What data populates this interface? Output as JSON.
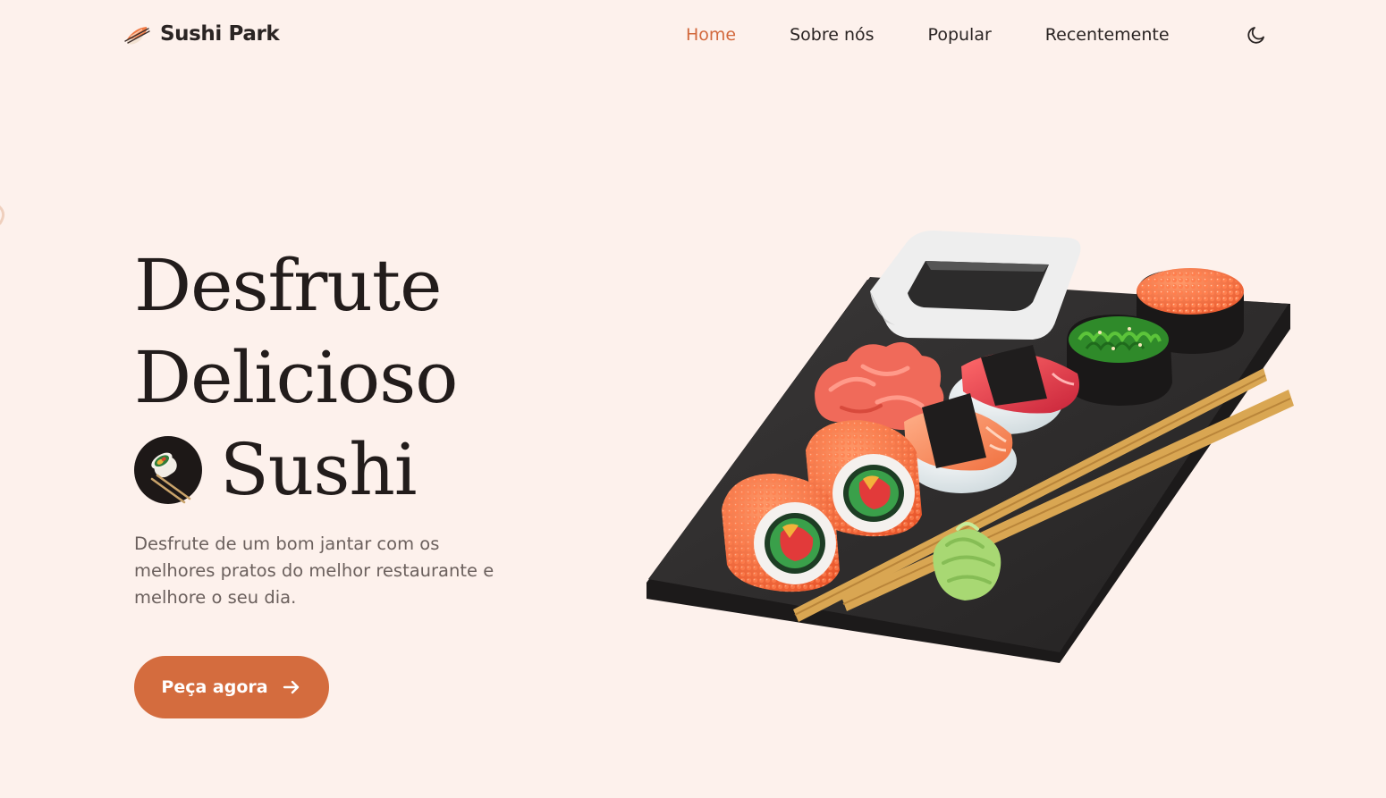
{
  "brand": {
    "name": "Sushi Park",
    "logo_icon": "sushi-logo-icon"
  },
  "nav": {
    "items": [
      {
        "label": "Home",
        "active": true
      },
      {
        "label": "Sobre nós",
        "active": false
      },
      {
        "label": "Popular",
        "active": false
      },
      {
        "label": "Recentemente",
        "active": false
      }
    ],
    "theme_icon": "moon-icon"
  },
  "hero": {
    "title_lines": [
      "Desfrute",
      "Delicioso",
      "Sushi"
    ],
    "title_badge_icon": "sushi-roll-chopsticks-icon",
    "description": "Desfrute de um bom jantar com os melhores pratos do melhor restaurante e melhore o seu dia.",
    "cta": {
      "label": "Peça agora",
      "icon": "arrow-right-icon"
    },
    "image_icon": "sushi-platter-illustration"
  },
  "colors": {
    "background": "#fdf1ec",
    "accent": "#d46c3e",
    "text": "#2a2423",
    "muted_text": "#6b605d"
  }
}
